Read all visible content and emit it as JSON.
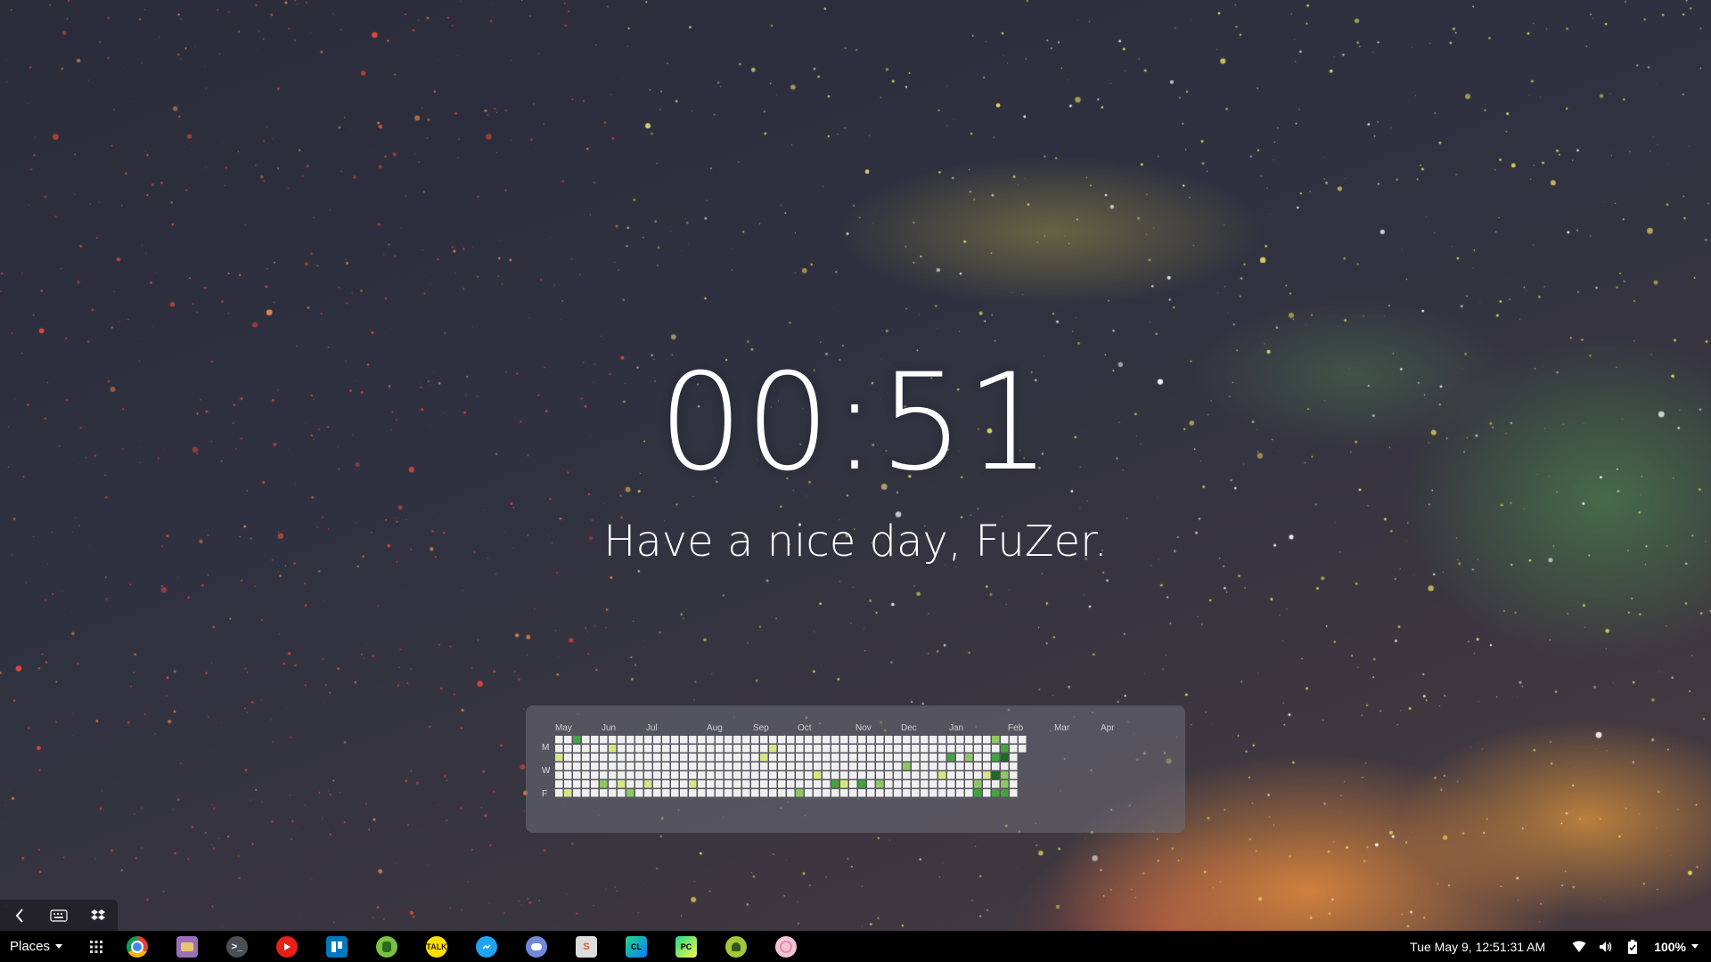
{
  "desktop": {
    "clock": "00:51",
    "greeting": "Have a nice day, FuZer."
  },
  "contribution_graph": {
    "months": [
      "May",
      "Jun",
      "Jul",
      "Aug",
      "Sep",
      "Oct",
      "Nov",
      "Dec",
      "Jan",
      "Feb",
      "Mar",
      "Apr"
    ],
    "day_labels": [
      "M",
      "W",
      "F"
    ],
    "colors": [
      "#f0f0f0",
      "#d6e685",
      "#8cc665",
      "#44a340",
      "#1e6823"
    ]
  },
  "corner_panel": {
    "icons": [
      "back-arrow-icon",
      "keyboard-icon",
      "dropbox-icon"
    ]
  },
  "taskbar": {
    "places_label": "Places",
    "apps": [
      {
        "name": "chrome",
        "color": "#4285f4"
      },
      {
        "name": "files",
        "color": "#b58bd0"
      },
      {
        "name": "terminal",
        "color": "#555a60"
      },
      {
        "name": "youtube",
        "color": "#e62117"
      },
      {
        "name": "trello",
        "color": "#0079bf"
      },
      {
        "name": "evernote",
        "color": "#7ac143"
      },
      {
        "name": "kakaotalk",
        "color": "#f9e000"
      },
      {
        "name": "messenger",
        "color": "#1fa3f0"
      },
      {
        "name": "discord",
        "color": "#7289da"
      },
      {
        "name": "sublime",
        "color": "#e0e0e0"
      },
      {
        "name": "clion",
        "color": "#21d789"
      },
      {
        "name": "pycharm",
        "color": "#21d789"
      },
      {
        "name": "android-studio",
        "color": "#a4c639"
      },
      {
        "name": "app",
        "color": "#f2c4d4"
      }
    ],
    "datetime": "Tue May  9, 12:51:31 AM",
    "battery": "100%"
  }
}
